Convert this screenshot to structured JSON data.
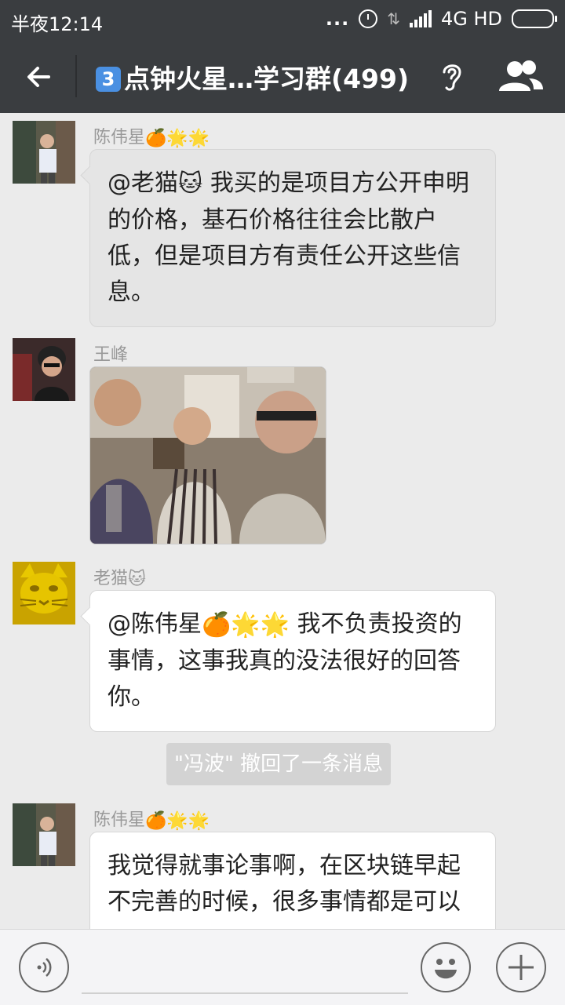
{
  "status_bar": {
    "time": "半夜12:14",
    "dots": "...",
    "network": "4G HD"
  },
  "header": {
    "badge": "3",
    "title": "点钟火星…学习群(499)"
  },
  "messages": [
    {
      "sender": "陈伟星",
      "text_prefix": "@老猫",
      "text": " 我买的是项目方公开申明的价格，基石价格往往会比散户低，但是项目方有责任公开这些信息。"
    },
    {
      "sender": "王峰"
    },
    {
      "sender": "老猫",
      "text_prefix": "@陈伟星",
      "text": " 我不负责投资的事情，这事我真的没法很好的回答你。"
    },
    {
      "system": "\"冯波\" 撤回了一条消息"
    },
    {
      "sender": "陈伟星",
      "text": "我觉得就事论事啊，在区块链早起不完善的时候，很多事情都是可以"
    }
  ],
  "colors": {
    "bar": "#3a3d40",
    "chat_bg": "#ebebeb",
    "bubble_gray": "#e5e5e5",
    "bubble_white": "#ffffff",
    "badge_blue": "#4a90e2"
  },
  "icons": {
    "back": "back-arrow-icon",
    "ear": "ear-icon",
    "members": "group-members-icon",
    "voice": "voice-input-icon",
    "emoji": "emoji-icon",
    "plus": "plus-icon"
  }
}
